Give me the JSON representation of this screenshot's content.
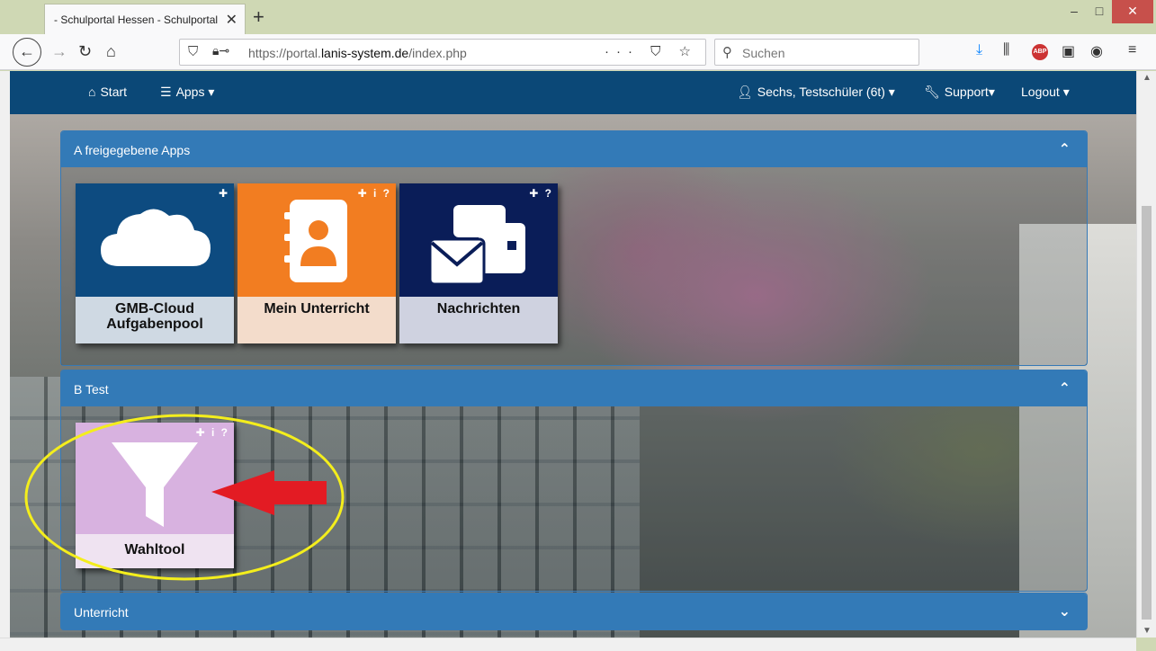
{
  "browser": {
    "tab_title": "- Schulportal Hessen - Schulportal Hessen",
    "tab_close": "✕",
    "new_tab": "+",
    "win_min": "–",
    "win_max": "□",
    "win_close": "✕",
    "url_prefix": "https://portal.",
    "url_domain": "lanis-system.de",
    "url_path": "/index.php",
    "url_actions": "··· ⛉ ☆",
    "search_placeholder": "Suchen"
  },
  "topnav": {
    "start": "Start",
    "apps": "Apps ▾",
    "user": "Sechs, Testschüler (6t) ▾",
    "support": "Support▾",
    "logout": "Logout ▾"
  },
  "panels": [
    {
      "title": "A freigegebene Apps",
      "chevron": "⌃",
      "tiles": [
        {
          "label": "GMB-Cloud Aufgabenpool",
          "flags": "✚",
          "color": "#0d4b80",
          "label_bg": "#cfd9e3"
        },
        {
          "label": "Mein Unterricht",
          "flags": "✚ i ?",
          "color": "#f27d21",
          "label_bg": "#f3dccb"
        },
        {
          "label": "Nachrichten",
          "flags": "✚ ?",
          "color": "#0a1d58",
          "label_bg": "#cfd2e0"
        }
      ]
    },
    {
      "title": "B Test",
      "chevron": "⌃",
      "tiles": [
        {
          "label": "Wahltool",
          "flags": "✚ i ?",
          "color": "#d8b2e0",
          "label_bg": "#efe3f1"
        }
      ]
    },
    {
      "title": "Unterricht",
      "chevron": "⌄"
    }
  ],
  "annotation": {
    "ellipse_color": "#f4ee1c",
    "arrow_color": "#e31b23"
  }
}
